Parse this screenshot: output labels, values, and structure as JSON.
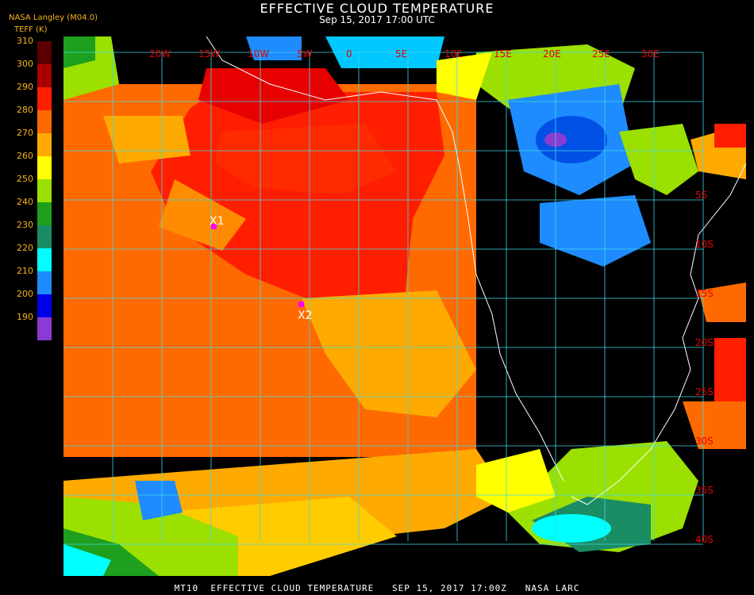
{
  "header": {
    "title": "EFFECTIVE CLOUD TEMPERATURE",
    "subtitle": "Sep 15, 2017 17:00 UTC",
    "provider": "NASA Langley (M04.0)",
    "units": "TEFF (K)"
  },
  "colorbar": {
    "labels": [
      "310",
      "300",
      "290",
      "280",
      "270",
      "260",
      "250",
      "240",
      "230",
      "220",
      "210",
      "200",
      "190"
    ],
    "colors": [
      "#5a0000",
      "#a80000",
      "#ff1e00",
      "#ff6a00",
      "#ffaa00",
      "#ffff00",
      "#9be000",
      "#1ea01e",
      "#1a8c64",
      "#00ffff",
      "#1e8cff",
      "#0000e6",
      "#8a3cd2"
    ]
  },
  "map": {
    "grid_color": "#40d8e6",
    "lat_labels": [
      "5S",
      "10S",
      "15S",
      "20S",
      "25S",
      "30S",
      "35S",
      "40S"
    ],
    "lon_labels": [
      "20W",
      "15W",
      "10W",
      "5W",
      "0",
      "5E",
      "10E",
      "15E",
      "20E",
      "25E",
      "30E"
    ],
    "land_shading": "#000000",
    "coastline_color": "#ffffff",
    "markers": [
      {
        "label": "X1",
        "color": "#ff00ff"
      },
      {
        "label": "X2",
        "color": "#ff00ff"
      }
    ]
  },
  "footer": {
    "text": "MT10  EFFECTIVE CLOUD TEMPERATURE   SEP 15, 2017 17:00Z   NASA LARC"
  }
}
